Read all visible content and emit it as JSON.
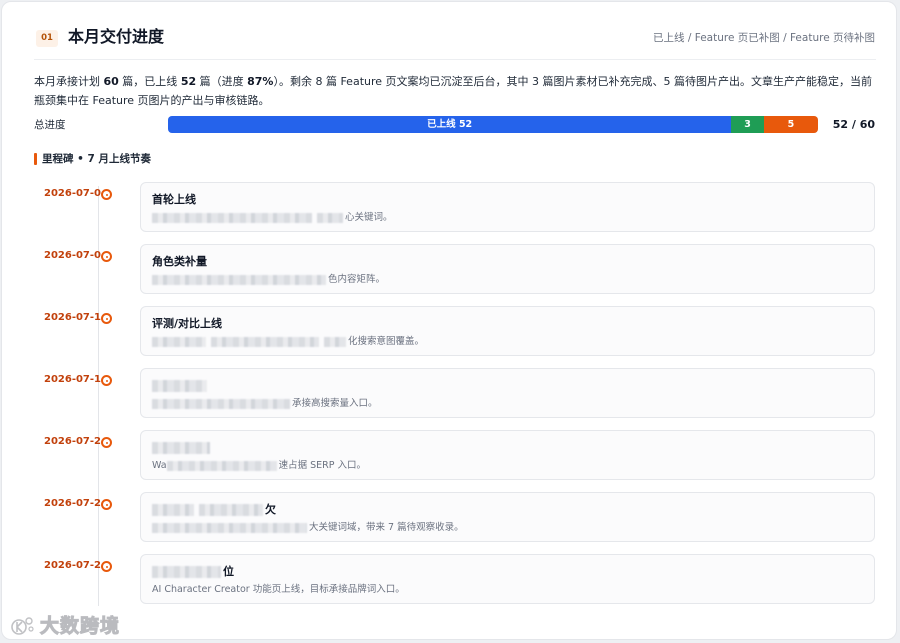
{
  "section": {
    "index": "01",
    "title": "本月交付进度",
    "legend": "已上线 / Feature 页已补图 / Feature 页待补图"
  },
  "summary": {
    "t1": "本月承接计划 ",
    "planned": "60",
    "t2": " 篇，已上线 ",
    "launched": "52",
    "t3": " 篇（进度 ",
    "percent": "87%",
    "t4": "）。剩余 8 篇 Feature 页文案均已沉淀至后台，其中 3 篇图片素材已补充完成、5 篇待图片产出。文章生产产能稳定，当前瓶颈集中在 Feature 页图片的产出与审核链路。"
  },
  "progress": {
    "label": "总进度",
    "total": 60,
    "segments": [
      {
        "label": "已上线 52",
        "value": 52,
        "color": "#2563eb"
      },
      {
        "label": "3",
        "value": 3,
        "color": "#1f9d55"
      },
      {
        "label": "5",
        "value": 5,
        "color": "#e8590c"
      }
    ],
    "count_text": "52 / 60"
  },
  "milestones": {
    "heading": "里程碑 • 7 月上线节奏",
    "items": [
      {
        "date": "2026-07-0",
        "title": "首轮上线",
        "desc": "心关键词。"
      },
      {
        "date": "2026-07-0",
        "title": "角色类补量",
        "desc": "色内容矩阵。"
      },
      {
        "date": "2026-07-1",
        "title": "评测/对比上线",
        "desc": "化搜索意图覆盖。"
      },
      {
        "date": "2026-07-1",
        "desc": "承接高搜索量入口。"
      },
      {
        "date": "2026-07-2",
        "desc_lead": "Wa",
        "desc": "速占据 SERP 入口。"
      },
      {
        "date": "2026-07-2",
        "title_tail": "欠",
        "desc": "大关键词域，带来 7 篇待观察收录。"
      },
      {
        "date": "2026-07-2",
        "title_tail": "位",
        "desc": "AI Character Creator 功能页上线，目标承接品牌词入口。"
      }
    ]
  },
  "watermark": "大数跨境"
}
